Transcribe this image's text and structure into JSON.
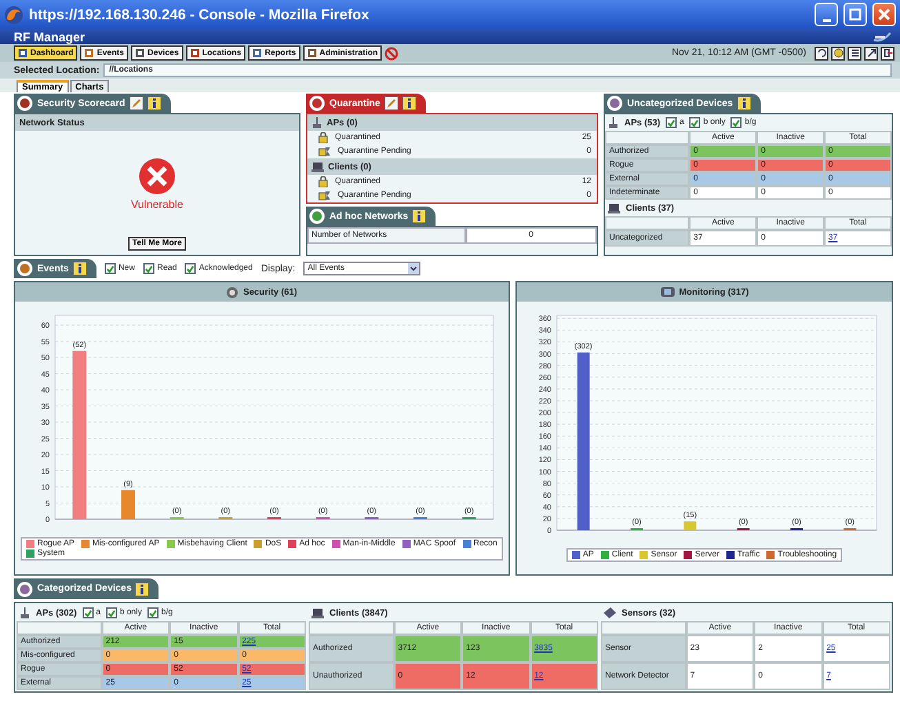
{
  "window": {
    "title": "https://192.168.130.246 - Console - Mozilla Firefox"
  },
  "app": {
    "title": "RF Manager"
  },
  "toolbar": {
    "items": [
      {
        "label": "Dashboard",
        "selected": true
      },
      {
        "label": "Events",
        "selected": false
      },
      {
        "label": "Devices",
        "selected": false
      },
      {
        "label": "Locations",
        "selected": false
      },
      {
        "label": "Reports",
        "selected": false
      },
      {
        "label": "Administration",
        "selected": false
      }
    ],
    "datetime": "Nov 21, 10:12 AM (GMT -0500)"
  },
  "location": {
    "label": "Selected Location:",
    "value": "//Locations"
  },
  "tabs": [
    {
      "label": "Summary",
      "selected": true
    },
    {
      "label": "Charts",
      "selected": false
    }
  ],
  "security_scorecard": {
    "title": "Security Scorecard",
    "section": "Network Status",
    "status": "Vulnerable",
    "button": "Tell Me More"
  },
  "quarantine": {
    "title": "Quarantine",
    "groups": [
      {
        "title": "APs (0)",
        "kind": "ap",
        "rows": [
          {
            "label": "Quarantined",
            "value": "25",
            "kind": "done"
          },
          {
            "label": "Quarantine Pending",
            "value": "0",
            "kind": "pending"
          }
        ]
      },
      {
        "title": "Clients (0)",
        "kind": "client",
        "rows": [
          {
            "label": "Quarantined",
            "value": "12",
            "kind": "done"
          },
          {
            "label": "Quarantine Pending",
            "value": "0",
            "kind": "pending"
          }
        ]
      }
    ]
  },
  "adhoc": {
    "title": "Ad hoc Networks",
    "rows": [
      {
        "label": "Number of Networks",
        "value": "0"
      }
    ]
  },
  "uncategorized": {
    "title": "Uncategorized Devices",
    "aps": {
      "title": "APs (53)",
      "kind": "ap",
      "filters": [
        {
          "label": "a",
          "checked": true
        },
        {
          "label": "b only",
          "checked": true
        },
        {
          "label": "b/g",
          "checked": true
        }
      ],
      "columns": [
        "Active",
        "Inactive",
        "Total"
      ],
      "rows": [
        {
          "label": "Authorized",
          "color": "#7cc45e",
          "cells": [
            "0",
            "0",
            "0"
          ],
          "total_link": false
        },
        {
          "label": "Rogue",
          "color": "#ee6c64",
          "cells": [
            "0",
            "0",
            "0"
          ],
          "total_link": false
        },
        {
          "label": "External",
          "color": "#a8c8e8",
          "cells": [
            "0",
            "0",
            "0"
          ],
          "total_link": false
        },
        {
          "label": "Indeterminate",
          "color": "#ffffff",
          "cells": [
            "0",
            "0",
            "0"
          ],
          "total_link": false
        }
      ]
    },
    "clients": {
      "title": "Clients (37)",
      "kind": "client",
      "columns": [
        "Active",
        "Inactive",
        "Total"
      ],
      "rows": [
        {
          "label": "Uncategorized",
          "color": "#ffffff",
          "cells": [
            "37",
            "0",
            "37"
          ],
          "total_link": true
        }
      ]
    }
  },
  "events": {
    "title": "Events",
    "filters": [
      {
        "label": "New",
        "checked": true
      },
      {
        "label": "Read",
        "checked": true
      },
      {
        "label": "Acknowledged",
        "checked": true
      }
    ],
    "display_label": "Display:",
    "display_value": "All Events"
  },
  "charts": [
    {
      "title": "Security (61)",
      "kind": "security",
      "chart_data": {
        "type": "bar",
        "grid": true,
        "ylim": [
          0,
          63
        ],
        "yticks": [
          0,
          5,
          10,
          15,
          20,
          25,
          30,
          35,
          40,
          45,
          50,
          55,
          60
        ],
        "value_labels": [
          "(52)",
          "(9)",
          "(0)",
          "(0)",
          "(0)",
          "(0)",
          "(0)",
          "(0)",
          "(0)"
        ],
        "series": [
          {
            "name": "Rogue AP",
            "color": "#f08080",
            "values": [
              52
            ]
          },
          {
            "name": "Mis-configured AP",
            "color": "#e8882c",
            "values": [
              9
            ]
          },
          {
            "name": "Misbehaving Client",
            "color": "#8cc84b",
            "values": [
              0
            ]
          },
          {
            "name": "DoS",
            "color": "#c8a030",
            "values": [
              0
            ]
          },
          {
            "name": "Ad hoc",
            "color": "#e0405a",
            "values": [
              0
            ]
          },
          {
            "name": "Man-in-Middle",
            "color": "#d050b0",
            "values": [
              0
            ]
          },
          {
            "name": "MAC Spoof",
            "color": "#9060c0",
            "values": [
              0
            ]
          },
          {
            "name": "Recon",
            "color": "#4a80d0",
            "values": [
              0
            ]
          },
          {
            "name": "System",
            "color": "#30a060",
            "values": [
              0
            ]
          }
        ]
      }
    },
    {
      "title": "Monitoring (317)",
      "kind": "monitoring",
      "chart_data": {
        "type": "bar",
        "grid": true,
        "ylim": [
          0,
          365
        ],
        "yticks": [
          0,
          20,
          40,
          60,
          80,
          100,
          120,
          140,
          160,
          180,
          200,
          220,
          240,
          260,
          280,
          300,
          320,
          340,
          360
        ],
        "value_labels": [
          "(302)",
          "(0)",
          "(15)",
          "(0)",
          "(0)",
          "(0)"
        ],
        "series": [
          {
            "name": "AP",
            "color": "#5060c8",
            "values": [
              302
            ]
          },
          {
            "name": "Client",
            "color": "#30b040",
            "values": [
              0
            ]
          },
          {
            "name": "Sensor",
            "color": "#d8c830",
            "values": [
              15
            ]
          },
          {
            "name": "Server",
            "color": "#a01840",
            "values": [
              0
            ]
          },
          {
            "name": "Traffic",
            "color": "#202890",
            "values": [
              0
            ]
          },
          {
            "name": "Troubleshooting",
            "color": "#d06830",
            "values": [
              0
            ]
          }
        ]
      }
    }
  ],
  "categorized": {
    "title": "Categorized Devices",
    "tables": [
      {
        "title": "APs (302)",
        "kind": "ap",
        "filters": [
          {
            "label": "a",
            "checked": true
          },
          {
            "label": "b only",
            "checked": true
          },
          {
            "label": "b/g",
            "checked": true
          }
        ],
        "columns": [
          "Active",
          "Inactive",
          "Total"
        ],
        "rows": [
          {
            "label": "Authorized",
            "color": "#7cc45e",
            "cells": [
              "212",
              "15",
              "225"
            ],
            "total_link": true
          },
          {
            "label": "Mis-configured",
            "color": "#fbb866",
            "cells": [
              "0",
              "0",
              "0"
            ],
            "total_link": false
          },
          {
            "label": "Rogue",
            "color": "#ee6c64",
            "cells": [
              "0",
              "52",
              "52"
            ],
            "total_link": true
          },
          {
            "label": "External",
            "color": "#a8c8e8",
            "cells": [
              "25",
              "0",
              "25"
            ],
            "total_link": true
          }
        ]
      },
      {
        "title": "Clients (3847)",
        "kind": "client",
        "columns": [
          "Active",
          "Inactive",
          "Total"
        ],
        "rows": [
          {
            "label": "Authorized",
            "color": "#7cc45e",
            "cells": [
              "3712",
              "123",
              "3835"
            ],
            "total_link": true
          },
          {
            "label": "Unauthorized",
            "color": "#ee6c64",
            "cells": [
              "0",
              "12",
              "12"
            ],
            "total_link": true
          }
        ]
      },
      {
        "title": "Sensors (32)",
        "kind": "sensor",
        "columns": [
          "Active",
          "Inactive",
          "Total"
        ],
        "rows": [
          {
            "label": "Sensor",
            "color": "#ffffff",
            "cells": [
              "23",
              "2",
              "25"
            ],
            "total_link": true
          },
          {
            "label": "Network Detector",
            "color": "#ffffff",
            "cells": [
              "7",
              "0",
              "7"
            ],
            "total_link": true
          }
        ]
      }
    ]
  }
}
